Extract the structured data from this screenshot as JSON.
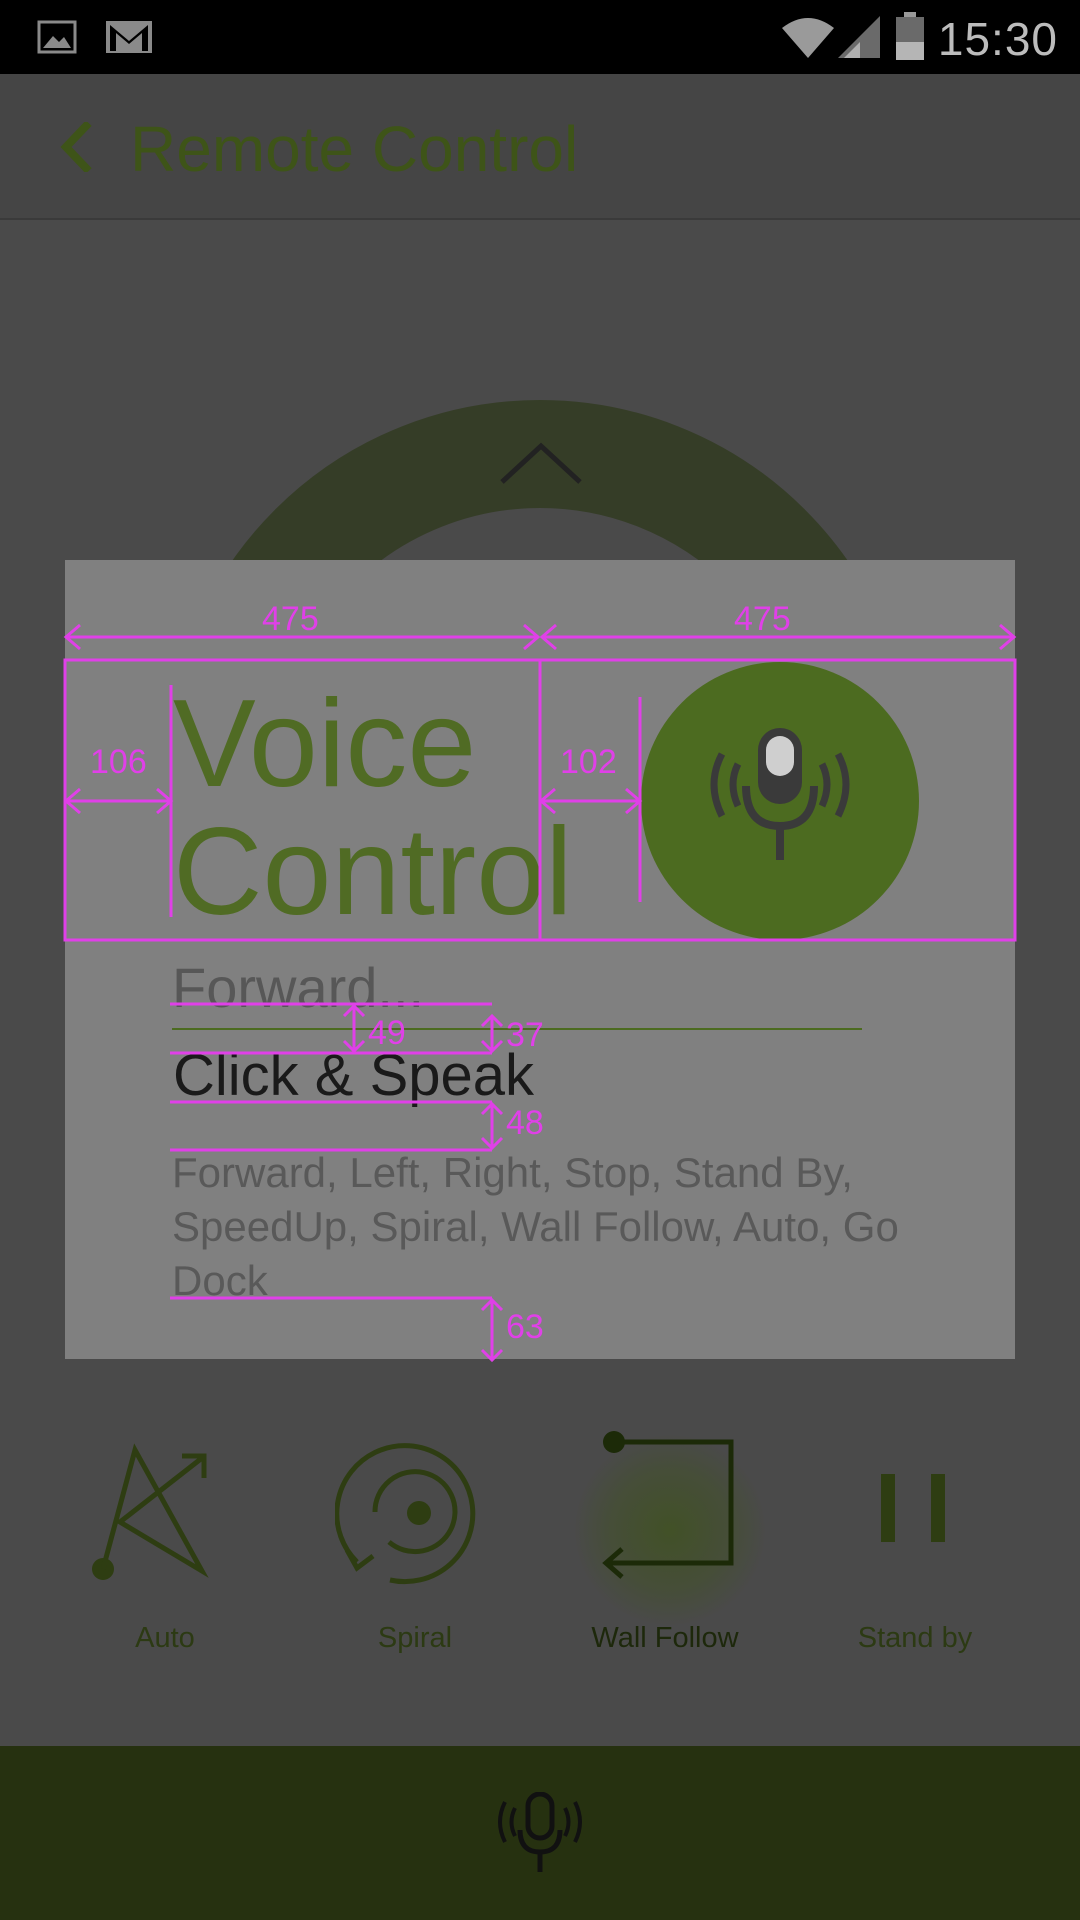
{
  "status_bar": {
    "time": "15:30",
    "icons": [
      "image-icon",
      "gmail-icon",
      "wifi-icon",
      "signal-icon",
      "battery-icon"
    ]
  },
  "app_bar": {
    "title": "Remote Control",
    "back_icon": "chevron-left-icon"
  },
  "dialog": {
    "title_line1": "Voice",
    "title_line2": "Control",
    "mic_icon": "microphone-icon",
    "input_value": "Forward...",
    "click_speak": "Click & Speak",
    "commands_hint": "Forward, Left, Right, Stop, Stand By, SpeedUp, Spiral, Wall Follow, Auto, Go Dock"
  },
  "annotations": {
    "width_left": "475",
    "width_right": "475",
    "pad_left": "106",
    "pad_right": "102",
    "gap_a": "49",
    "gap_b": "37",
    "gap_c": "48",
    "gap_d": "63"
  },
  "modes": [
    {
      "label": "Auto",
      "icon": "auto-path-icon"
    },
    {
      "label": "Spiral",
      "icon": "spiral-icon"
    },
    {
      "label": "Wall Follow",
      "icon": "wall-follow-icon"
    },
    {
      "label": "Stand by",
      "icon": "pause-icon"
    }
  ],
  "bottom_bar": {
    "icon": "microphone-icon"
  },
  "colors": {
    "accent": "#4c6b20",
    "annotation": "#e040e8",
    "bottom_bar": "#263110"
  }
}
